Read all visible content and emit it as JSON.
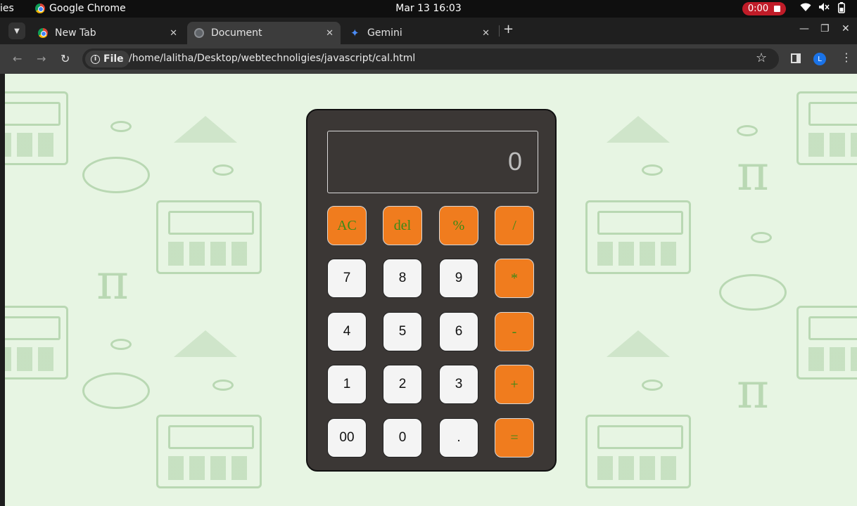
{
  "topbar": {
    "activities": "ies",
    "app_name": "Google Chrome",
    "datetime": "Mar 13  16:03",
    "recording_time": "0:00"
  },
  "tabs": [
    {
      "title": "New Tab",
      "icon": "chrome-icon",
      "active": false
    },
    {
      "title": "Document",
      "icon": "globe-icon",
      "active": true
    },
    {
      "title": "Gemini",
      "icon": "gemini-icon",
      "active": false
    }
  ],
  "address_bar": {
    "chip_label": "File",
    "url": "/home/lalitha/Desktop/webtechnoligies/javascript/cal.html",
    "profile_initial": "L"
  },
  "calculator": {
    "display": "0",
    "keys": {
      "ac": "AC",
      "del": "del",
      "percent": "%",
      "divide": "/",
      "k7": "7",
      "k8": "8",
      "k9": "9",
      "multiply": "*",
      "k4": "4",
      "k5": "5",
      "k6": "6",
      "minus": "-",
      "k1": "1",
      "k2": "2",
      "k3": "3",
      "plus": "+",
      "k00": "00",
      "k0": "0",
      "dot": ".",
      "equals": "="
    }
  },
  "colors": {
    "operator_key": "#f07c1e",
    "operator_text": "#3a8a18",
    "calculator_body": "#3b3735",
    "page_background": "#e7f5e3",
    "recording_badge": "#c01c28"
  }
}
